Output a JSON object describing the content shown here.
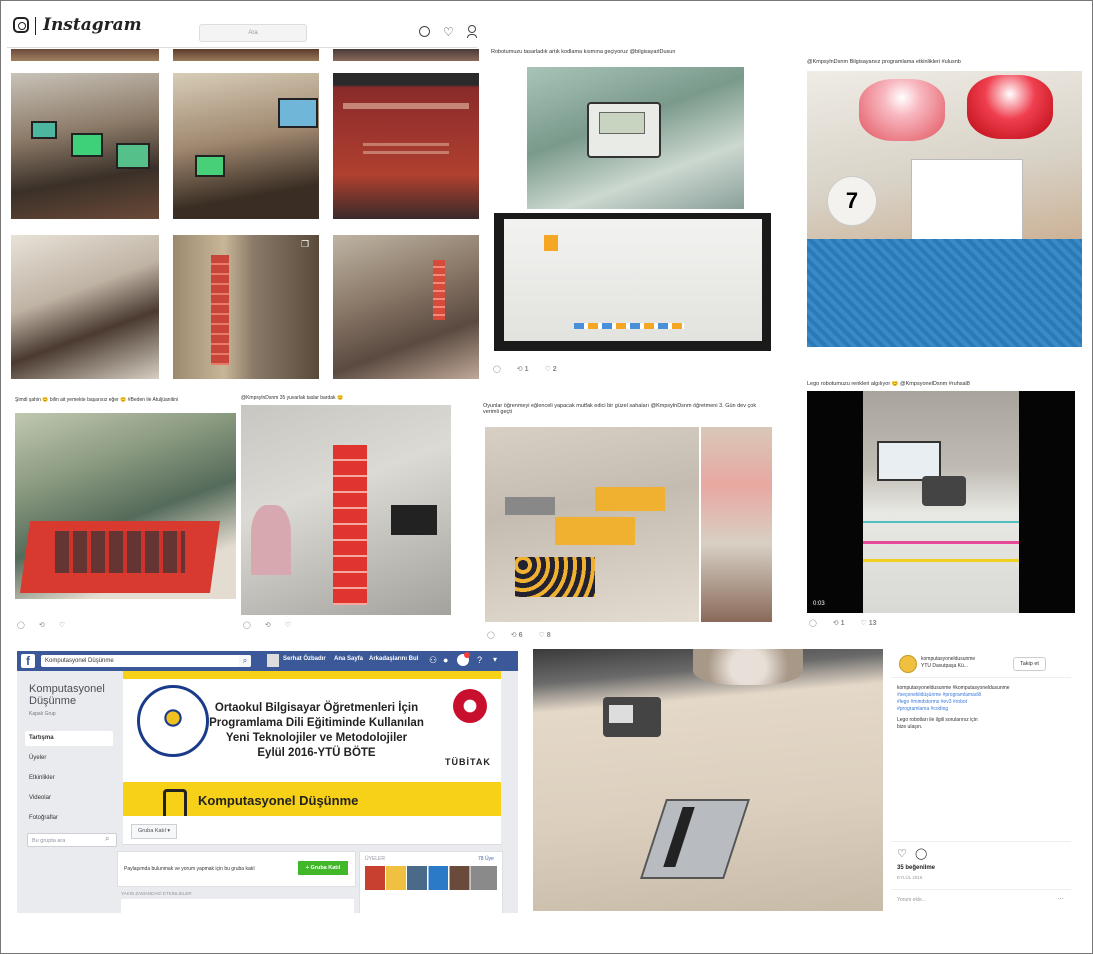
{
  "instagram": {
    "wordmark": "Instagram",
    "search_placeholder": "Ara"
  },
  "posts": {
    "robot_arduino_caption": "Robotumuzu tasarladık artık kodlama kısmına geçiyoruz @bilgisayarlDusun",
    "robot_arduino_stats": {
      "comments": "1",
      "likes": "2"
    },
    "binary_caption": "@KmpsylnDsnm Bilgisayarsız programlama etkinlikleri #ulusnb",
    "lego_caption": "Lego robotumuzu renkleri algılıyor 😊 @KmpsyonelDsnm #ruhsal8",
    "lego_stats": {
      "comments": "1",
      "likes": "13"
    },
    "lego_video_time": "0:03",
    "cups_caption": "@KmpsylnDsnm 35 yuvarlak taslar bardak 😊",
    "workshop_caption": "Şimdi şahin 😊 bilin ait yemekte başarısız eğer 😊 #Beden ile Atuljüanitini",
    "games_caption": "Oyunlar öğrenmeyi eğlenceli yapacak mutfak edici bir güzel sahaları @KmpsylnDsnm öğretmeni 3. Gün dev çok verimli geçti",
    "games_stats": {
      "comments": "6",
      "likes": "8"
    }
  },
  "facebook": {
    "search_value": "Komputasyonel Düşünme",
    "nav": [
      "Serhat Özbadır",
      "Ana Sayfa",
      "Arkadaşlarını Bul"
    ],
    "group_name": "Komputasyonel Düşünme",
    "group_type": "Kapalı Grup",
    "menu": [
      "Tartışma",
      "Üyeler",
      "Etkinlikler",
      "Videolar",
      "Fotoğraflar"
    ],
    "search_group_placeholder": "Bu grupta ara",
    "cover_lines": [
      "Ortaokul Bilgisayar Öğretmenleri İçin",
      "Programlama Dili Eğitiminde Kullanılan",
      "Yeni Teknolojiler ve Metodolojiler",
      "Eylül 2016-YTÜ BÖTE"
    ],
    "tubitak": "TÜBİTAK",
    "subtitle_partial": "Komputasyonel Düşünme",
    "joined_button": "Gruba Katıl",
    "share_prompt": "Paylaşımda bulunmak ve yorum yapmak için bu gruba katıl",
    "join_button": "+ Gruba Katıl",
    "members_label": "ÜYELER",
    "members_count": "78 Üye",
    "recent_label": "YAKIN ZAMANDAKİ ETKİNLİKLER"
  },
  "ig_side": {
    "username": "komputasyoneldusunme",
    "location": "YTÜ Davutpaşa Kü...",
    "follow_button": "Takip et",
    "caption_lines": [
      "komputasyoneldusunme #komputasyoneldusunme",
      "#seçeneklidüşünme #programlamadili",
      "#lego #mindstorms #ev3 #robot",
      "#programlama #coding"
    ],
    "comment_lines": [
      "Lego robotları ile ilgili sorularınız için",
      "bize ulaşın."
    ],
    "likes": "35 beğenilme",
    "date": "EYLÜL 2016",
    "comment_placeholder": "Yorum ekle..."
  },
  "colors": {
    "fb_blue": "#3b5998",
    "link_blue": "#3b7ad9",
    "cover_yellow": "#f7d117",
    "join_green": "#42b72a"
  }
}
